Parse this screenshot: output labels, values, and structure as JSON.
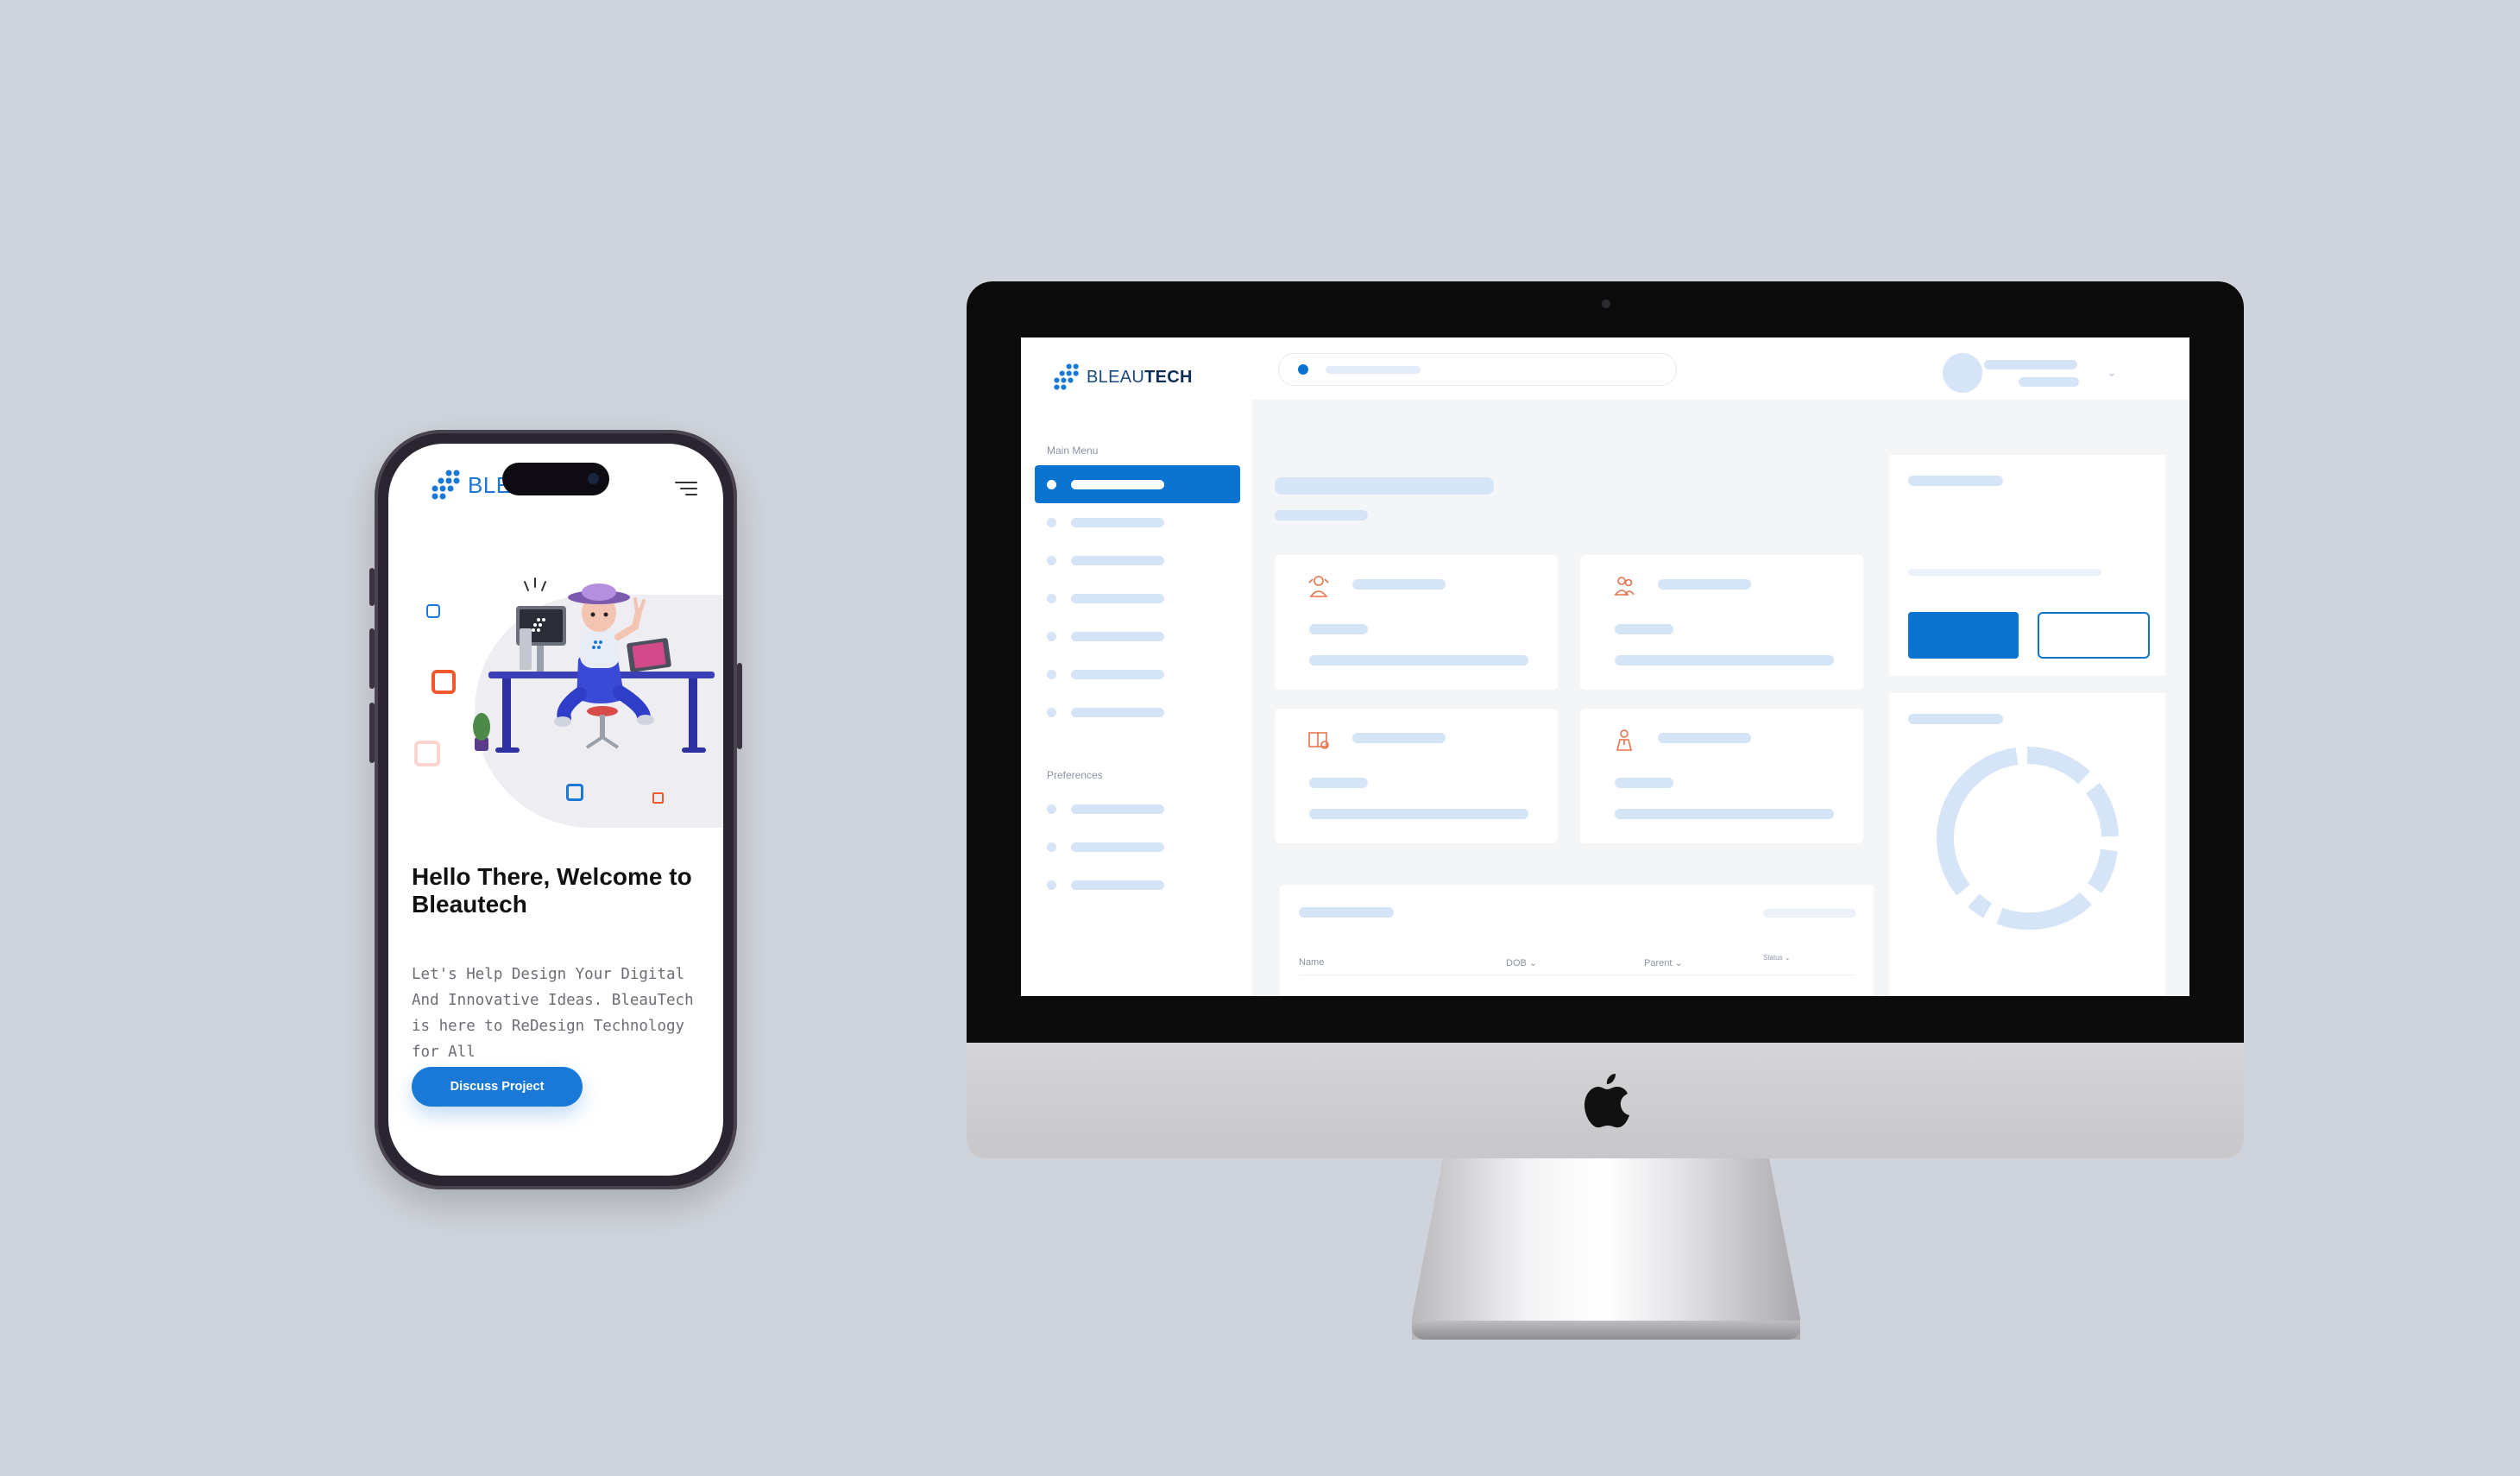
{
  "mobile": {
    "logo_text": "BLEA",
    "heading": "Hello There, Welcome to Bleautech",
    "description": "Let's Help Design Your  Digital And Innovative Ideas. BleauTech is here to ReDesign Technology for All",
    "cta_label": "Discuss Project",
    "accent_color": "#1a78d6"
  },
  "desktop": {
    "logo_text_light": "BLEAU",
    "logo_text_bold": "TECH",
    "sidebar": {
      "main_menu_label": "Main Menu",
      "preferences_label": "Preferences",
      "active_color": "#0b74d1"
    },
    "table": {
      "columns": [
        "Name",
        "DOB",
        "Parent",
        "Status"
      ]
    }
  }
}
